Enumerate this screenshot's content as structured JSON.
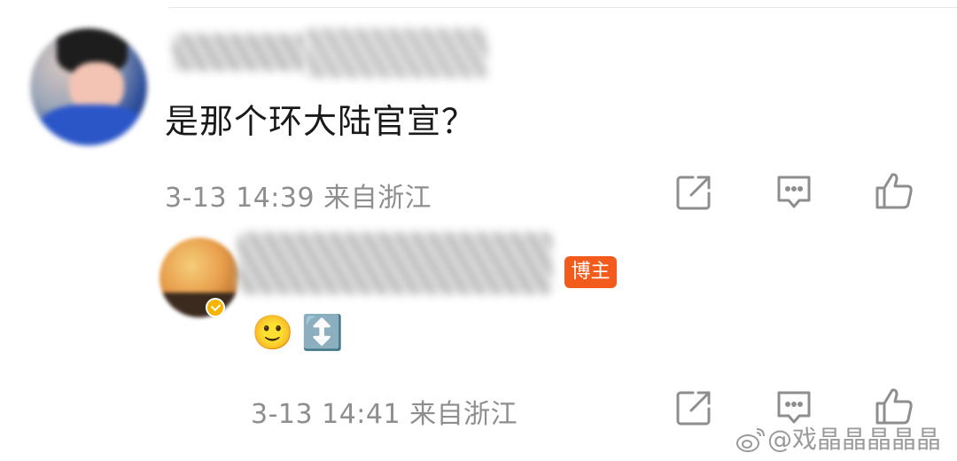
{
  "comment": {
    "text": "是那个环大陆官宣？",
    "meta": "3-13 14:39  来自浙江",
    "icons": [
      "share-icon",
      "reply-comment-icon",
      "like-thumb-icon"
    ]
  },
  "reply": {
    "badge": "博主",
    "emojis": [
      "🙂",
      "↕️"
    ],
    "meta": "3-13 14:41  来自浙江",
    "icons": [
      "share-icon",
      "reply-comment-icon",
      "like-thumb-icon"
    ]
  },
  "watermark": {
    "text": "@戏晶晶晶晶晶"
  },
  "colors": {
    "badge": "#f25b1b",
    "meta": "#8e8e8e",
    "text": "#1a1a1a",
    "verified": "#f6b400"
  }
}
